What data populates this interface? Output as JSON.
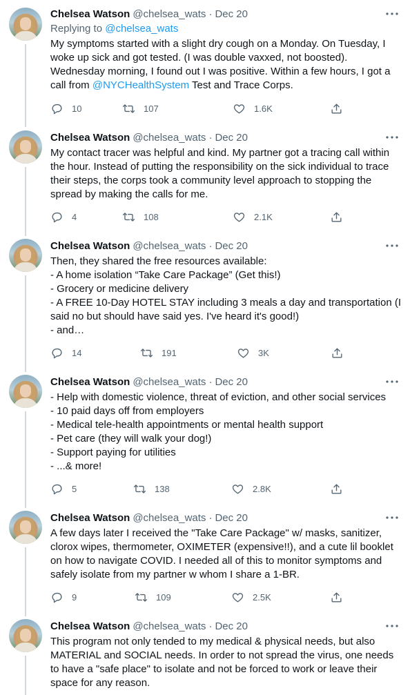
{
  "author": {
    "name": "Chelsea Watson",
    "handle": "@chelsea_wats",
    "separator": "·"
  },
  "replying": {
    "prefix": "Replying to",
    "handle": "@chelsea_wats"
  },
  "tweets": [
    {
      "date": "Dec 20",
      "lines": [
        "My symptoms started with a slight dry cough on a Monday. On Tuesday, I",
        "woke up sick and got tested. (I was double vaxxed, not boosted).",
        "Wednesday morning, I found out I was positive. Within a few hours, I got a"
      ],
      "last_line_prefix": "call from ",
      "last_line_link": "@NYCHealthSystem",
      "last_line_suffix": " Test and Trace Corps.",
      "replies": "10",
      "retweets": "107",
      "likes": "1.6K"
    },
    {
      "date": "Dec 20",
      "lines": [
        "My contact tracer was helpful and kind. My partner got a tracing call within",
        "the hour. Instead of putting the responsibility on the sick individual to trace",
        "their steps, the corps took a community level approach to stopping the",
        "spread by making the calls for me."
      ],
      "replies": "4",
      "retweets": "108",
      "likes": "2.1K"
    },
    {
      "date": "Dec 20",
      "lines": [
        "Then, they shared the free resources available:",
        "- A home isolation “Take Care Package” (Get this!)",
        "- Grocery or medicine delivery",
        "- A FREE 10-Day HOTEL STAY including 3 meals a day and transportation (I",
        "said no but should have said yes. I've heard it's good!)",
        "- and…"
      ],
      "replies": "14",
      "retweets": "191",
      "likes": "3K"
    },
    {
      "date": "Dec 20",
      "lines": [
        "- Help with domestic violence, threat of eviction, and other social services",
        "- 10 paid days off from employers",
        "- Medical tele-health appointments or mental health support",
        "- Pet care (they will walk your dog!)",
        "- Support paying for utilities",
        "- ...& more!"
      ],
      "replies": "5",
      "retweets": "138",
      "likes": "2.8K"
    },
    {
      "date": "Dec 20",
      "lines": [
        "A few days later I received the \"Take Care Package\" w/ masks, sanitizer,",
        "clorox wipes, thermometer, OXIMETER (expensive!!), and a cute lil booklet",
        "on how to navigate COVID. I needed all of this to monitor symptoms and",
        "safely isolate from my partner w whom I share a 1-BR."
      ],
      "replies": "9",
      "retweets": "109",
      "likes": "2.5K"
    },
    {
      "date": "Dec 20",
      "lines": [
        "This program not only tended to my medical & physical needs, but also",
        "MATERIAL and SOCIAL needs. In order to not spread the virus, one needs",
        "to have a \"safe place\" to isolate and not be forced to work or leave their",
        "space for any reason."
      ]
    }
  ],
  "icons": {
    "more": "more-horizontal-icon",
    "reply": "reply-bubble-icon",
    "retweet": "retweet-arrows-icon",
    "like": "heart-icon",
    "share": "share-upload-icon"
  },
  "colors": {
    "text": "#0f1419",
    "secondary": "#536471",
    "link": "#1d9bf0",
    "thread_line": "#cfd9de"
  }
}
